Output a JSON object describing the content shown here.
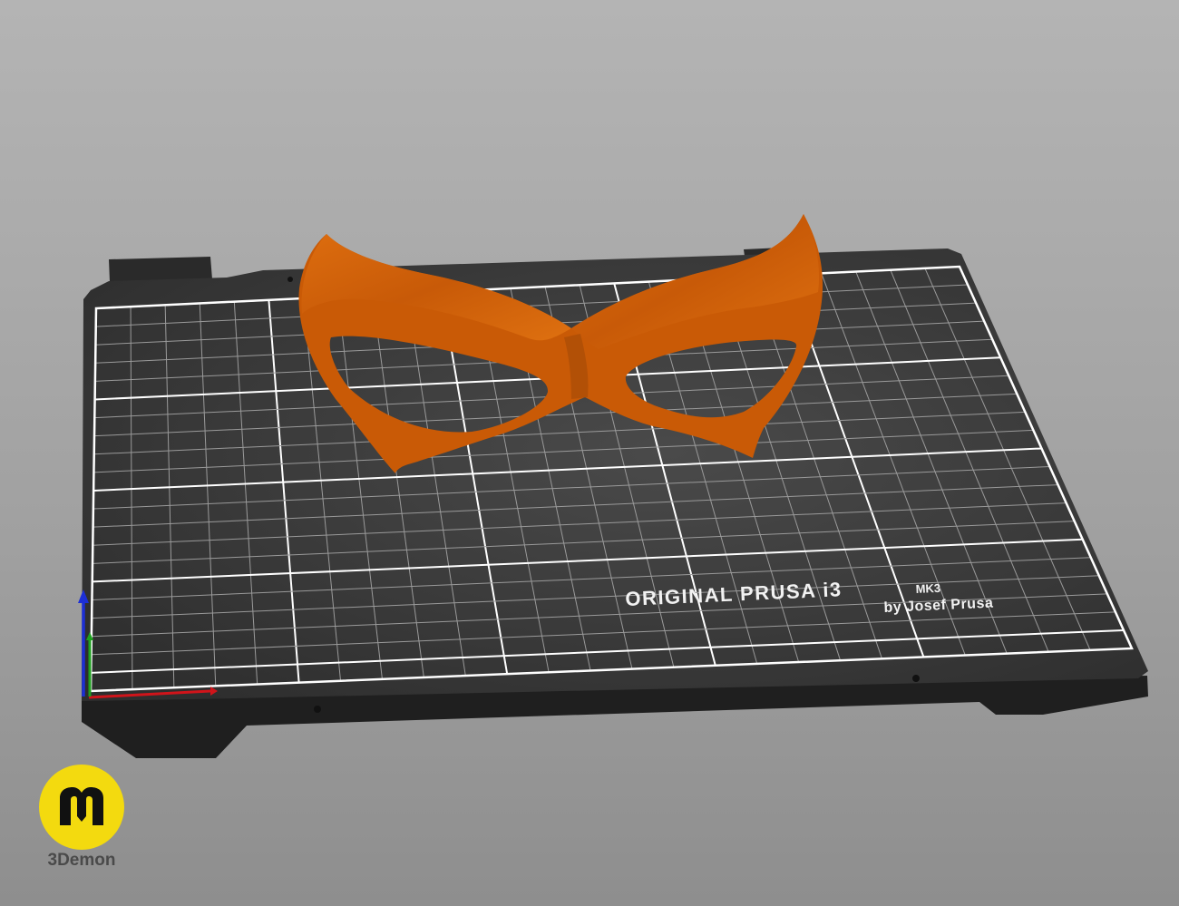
{
  "scene": {
    "bed": {
      "brand": "ORIGINAL PRUSA i3",
      "model": "MK3",
      "author": "by Josef Prusa"
    },
    "model_object": {
      "name": "mask",
      "color": "#d8650d"
    },
    "axes": {
      "x_color": "#d0141a",
      "y_color": "#1fa01f",
      "z_color": "#1c2fd6"
    }
  },
  "watermark": {
    "logo_icon": "3demon-logo-icon",
    "name": "3Demon",
    "color": "#f3da0f"
  }
}
